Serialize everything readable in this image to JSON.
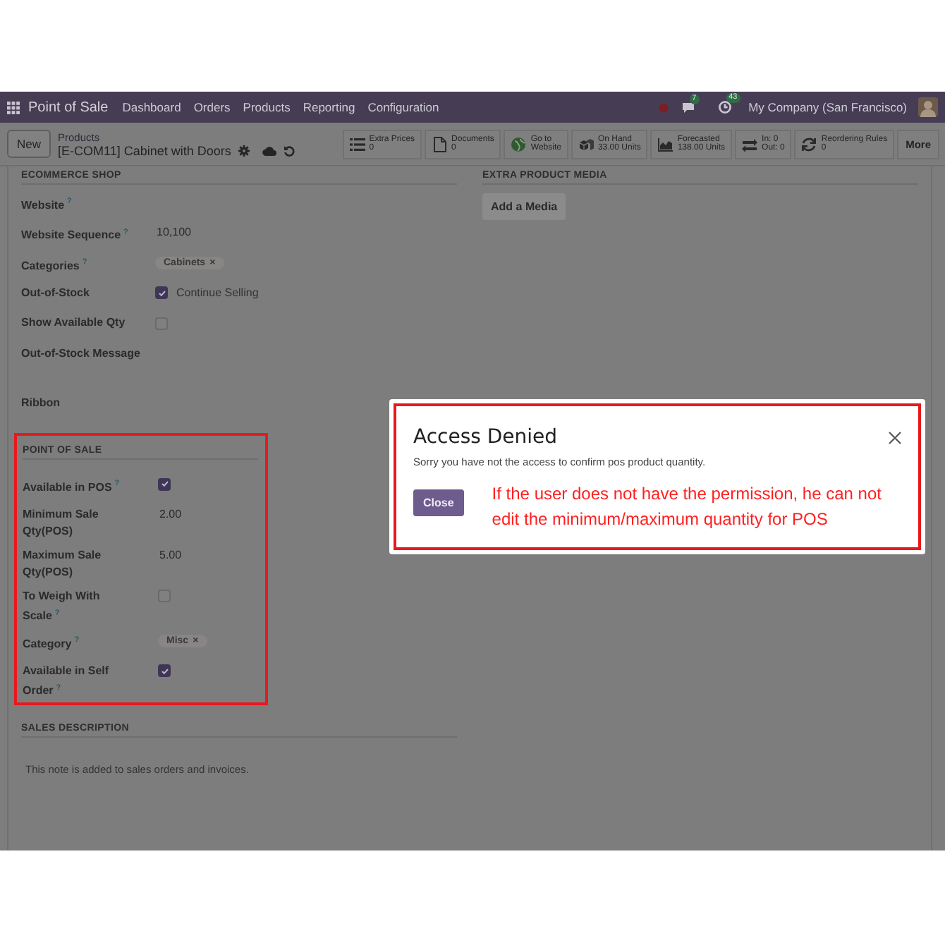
{
  "navbar": {
    "app_name": "Point of Sale",
    "menu": [
      "Dashboard",
      "Orders",
      "Products",
      "Reporting",
      "Configuration"
    ],
    "messages_badge": "7",
    "activity_badge": "43",
    "company": "My Company (San Francisco)"
  },
  "control_panel": {
    "new_button": "New",
    "breadcrumb": "Products",
    "record_title": "[E-COM11] Cabinet with Doors",
    "smart_buttons": [
      {
        "lines": [
          "Extra Prices",
          "0"
        ]
      },
      {
        "lines": [
          "Documents",
          "0"
        ]
      },
      {
        "lines": [
          "Go to",
          "Website"
        ]
      },
      {
        "lines": [
          "On Hand",
          "33.00 Units"
        ]
      },
      {
        "lines": [
          "Forecasted",
          "138.00 Units"
        ]
      },
      {
        "lines": [
          "In: 0",
          "Out: 0"
        ]
      },
      {
        "lines": [
          "Reordering Rules",
          "0"
        ]
      }
    ],
    "more_button": "More"
  },
  "ecommerce": {
    "heading": "ECOMMERCE SHOP",
    "fields": [
      {
        "kind": "empty",
        "label": "Website",
        "help": "?"
      },
      {
        "kind": "text",
        "label": "Website Sequence",
        "help": "?",
        "value": "10,100"
      },
      {
        "kind": "tags",
        "label": "Categories",
        "help": "?",
        "tags": [
          {
            "label": "Cabinets",
            "remove": "×"
          }
        ]
      },
      {
        "kind": "checkbox",
        "label": "Out-of-Stock",
        "checked": true,
        "caption": "Continue Selling"
      },
      {
        "kind": "checkbox",
        "label": "Show Available Qty",
        "checked": false
      },
      {
        "kind": "textarea",
        "label": "Out-of-Stock Message"
      },
      {
        "kind": "empty",
        "label": "Ribbon"
      }
    ]
  },
  "point_of_sale": {
    "heading": "POINT OF SALE",
    "fields": [
      {
        "kind": "checkbox",
        "label": "Available in POS",
        "help": "?",
        "checked": true
      },
      {
        "kind": "text",
        "label": "Minimum Sale Qty(POS)",
        "value": "2.00"
      },
      {
        "kind": "text",
        "label": "Maximum Sale Qty(POS)",
        "value": "5.00"
      },
      {
        "kind": "checkbox",
        "label": "To Weigh With Scale",
        "help": "?",
        "checked": false
      },
      {
        "kind": "tags",
        "label": "Category",
        "help": "?",
        "tags": [
          {
            "label": "Misc",
            "remove": "×"
          }
        ]
      },
      {
        "kind": "checkbox",
        "label": "Available in Self Order",
        "help": "?",
        "checked": true
      }
    ]
  },
  "sales_description": {
    "heading": "SALES DESCRIPTION",
    "placeholder": "This note is added to sales orders and invoices."
  },
  "extra_media": {
    "heading": "EXTRA PRODUCT MEDIA",
    "add_button": "Add a Media"
  },
  "dialog": {
    "title": "Access Denied",
    "message": "Sorry you have not the access to confirm pos product quantity.",
    "close_button": "Close",
    "annotation": "If the user does not have the permission, he can not edit the minimum/maximum quantity for POS"
  }
}
